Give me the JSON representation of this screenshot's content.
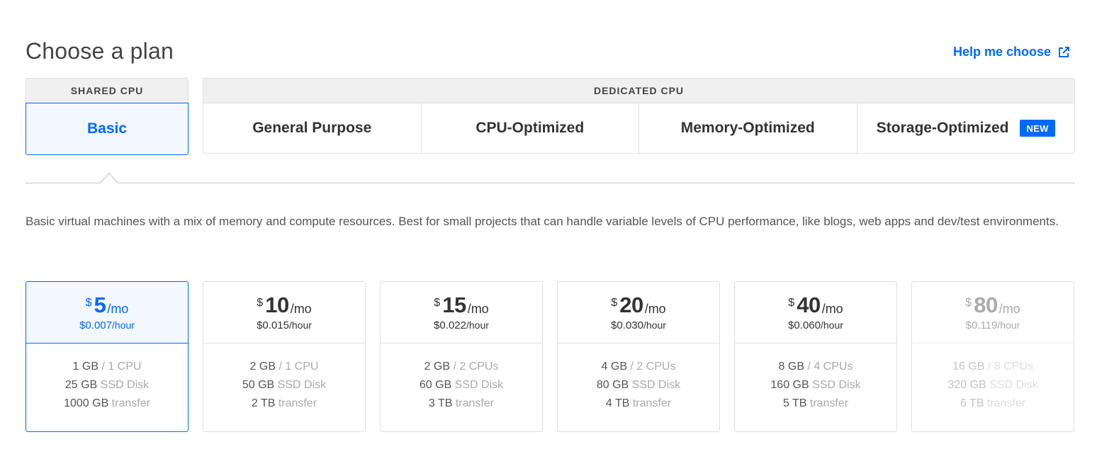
{
  "header": {
    "title": "Choose a plan",
    "help_link": "Help me choose",
    "help_icon": "external-link-icon"
  },
  "categories": {
    "shared": {
      "label": "SHARED CPU",
      "tabs": [
        {
          "label": "Basic",
          "active": true
        }
      ]
    },
    "dedicated": {
      "label": "DEDICATED CPU",
      "tabs": [
        {
          "label": "General Purpose"
        },
        {
          "label": "CPU-Optimized"
        },
        {
          "label": "Memory-Optimized"
        },
        {
          "label": "Storage-Optimized",
          "badge": "NEW"
        }
      ]
    }
  },
  "description": "Basic virtual machines with a mix of memory and compute resources. Best for small projects that can handle variable levels of CPU performance, like blogs, web apps and dev/test environments.",
  "plans": [
    {
      "currency": "$",
      "price": "5",
      "per": "/mo",
      "hourly": "$0.007",
      "hour_unit": "/hour",
      "memory": "1 GB",
      "cpu": " / 1 CPU",
      "disk": "25 GB",
      "disk_label": " SSD Disk",
      "transfer": "1000 GB",
      "transfer_label": " transfer",
      "state": "selected"
    },
    {
      "currency": "$",
      "price": "10",
      "per": "/mo",
      "hourly": "$0.015",
      "hour_unit": "/hour",
      "memory": "2 GB",
      "cpu": " / 1 CPU",
      "disk": "50 GB",
      "disk_label": " SSD Disk",
      "transfer": "2 TB",
      "transfer_label": " transfer",
      "state": "normal"
    },
    {
      "currency": "$",
      "price": "15",
      "per": "/mo",
      "hourly": "$0.022",
      "hour_unit": "/hour",
      "memory": "2 GB",
      "cpu": " / 2 CPUs",
      "disk": "60 GB",
      "disk_label": " SSD Disk",
      "transfer": "3 TB",
      "transfer_label": " transfer",
      "state": "normal"
    },
    {
      "currency": "$",
      "price": "20",
      "per": "/mo",
      "hourly": "$0.030",
      "hour_unit": "/hour",
      "memory": "4 GB",
      "cpu": " / 2 CPUs",
      "disk": "80 GB",
      "disk_label": " SSD Disk",
      "transfer": "4 TB",
      "transfer_label": " transfer",
      "state": "normal"
    },
    {
      "currency": "$",
      "price": "40",
      "per": "/mo",
      "hourly": "$0.060",
      "hour_unit": "/hour",
      "memory": "8 GB",
      "cpu": " / 4 CPUs",
      "disk": "160 GB",
      "disk_label": " SSD Disk",
      "transfer": "5 TB",
      "transfer_label": " transfer",
      "state": "normal"
    },
    {
      "currency": "$",
      "price": "80",
      "per": "/mo",
      "hourly": "$0.119",
      "hour_unit": "/hour",
      "memory": "16 GB",
      "cpu": " / 8 CPUs",
      "disk": "320 GB",
      "disk_label": " SSD Disk",
      "transfer": "6 TB",
      "transfer_label": " transfer",
      "state": "disabled"
    }
  ],
  "colors": {
    "accent": "#0069ff",
    "selected_bg": "#f3f7fe",
    "border": "#dfdfdf",
    "header_bg": "#f0f0f0"
  }
}
